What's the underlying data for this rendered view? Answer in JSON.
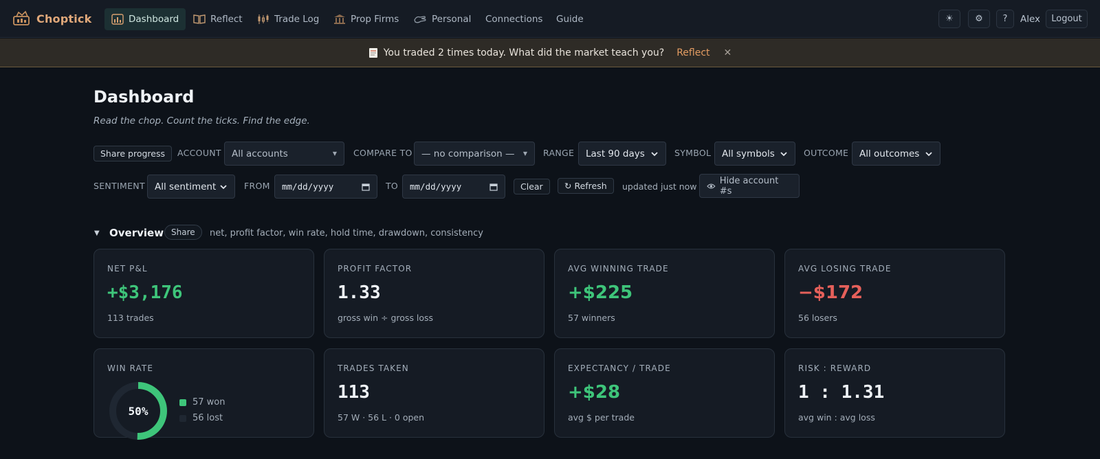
{
  "brand": {
    "name": "Choptick"
  },
  "nav": {
    "items": [
      {
        "label": "Dashboard",
        "icon": "chart-icon"
      },
      {
        "label": "Reflect",
        "icon": "book-icon"
      },
      {
        "label": "Trade Log",
        "icon": "candles-icon"
      },
      {
        "label": "Prop Firms",
        "icon": "bank-icon"
      },
      {
        "label": "Personal",
        "icon": "hand-icon"
      },
      {
        "label": "Connections"
      },
      {
        "label": "Guide"
      }
    ],
    "theme_icon": "☀",
    "settings_icon": "⚙",
    "help_label": "?",
    "user": "Alex",
    "logout_label": "Logout"
  },
  "banner": {
    "message": "You traded 2 times today. What did the market teach you?",
    "link": "Reflect",
    "close": "✕"
  },
  "page": {
    "title": "Dashboard",
    "subtitle": "Read the chop. Count the ticks. Find the edge."
  },
  "filters": {
    "share_progress": "Share progress",
    "account_label": "ACCOUNT",
    "account_value": "All accounts",
    "compare_label": "COMPARE TO",
    "compare_value": "— no comparison —",
    "range_label": "RANGE",
    "range_value": "Last 90 days",
    "symbol_label": "SYMBOL",
    "symbol_value": "All symbols",
    "outcome_label": "OUTCOME",
    "outcome_value": "All outcomes",
    "sentiment_label": "SENTIMENT",
    "sentiment_value": "All sentiment",
    "from_label": "FROM",
    "from_placeholder": "mm/dd/yyyy",
    "to_label": "TO",
    "to_placeholder": "mm/dd/yyyy",
    "clear": "Clear",
    "refresh": "↻ Refresh",
    "updated": "updated just now",
    "hide_accounts": "Hide account #s"
  },
  "overview": {
    "title": "Overview",
    "share": "Share",
    "description": "net, profit factor, win rate, hold time, drawdown, consistency"
  },
  "cards": {
    "net_pnl": {
      "label": "NET P&L",
      "value": "+$3,176",
      "sub": "113 trades"
    },
    "profit_factor": {
      "label": "PROFIT FACTOR",
      "value": "1.33",
      "sub": "gross win ÷ gross loss"
    },
    "avg_win": {
      "label": "AVG WINNING TRADE",
      "value": "+$225",
      "sub": "57 winners"
    },
    "avg_loss": {
      "label": "AVG LOSING TRADE",
      "value": "−$172",
      "sub": "56 losers"
    },
    "win_rate": {
      "label": "WIN RATE",
      "value": "50%",
      "won": "57 won",
      "lost": "56 lost",
      "won_fraction": 0.5044
    },
    "trades_taken": {
      "label": "TRADES TAKEN",
      "value": "113",
      "sub": "57 W · 56 L · 0 open"
    },
    "expectancy": {
      "label": "EXPECTANCY / TRADE",
      "value": "+$28",
      "sub": "avg $ per trade"
    },
    "risk_reward": {
      "label": "RISK : REWARD",
      "value": "1 : 1.31",
      "sub": "avg win : avg loss"
    }
  },
  "colors": {
    "positive": "#3ec57a",
    "negative": "#e5605a",
    "accent": "#e39c62",
    "lost": "#1f2732"
  }
}
